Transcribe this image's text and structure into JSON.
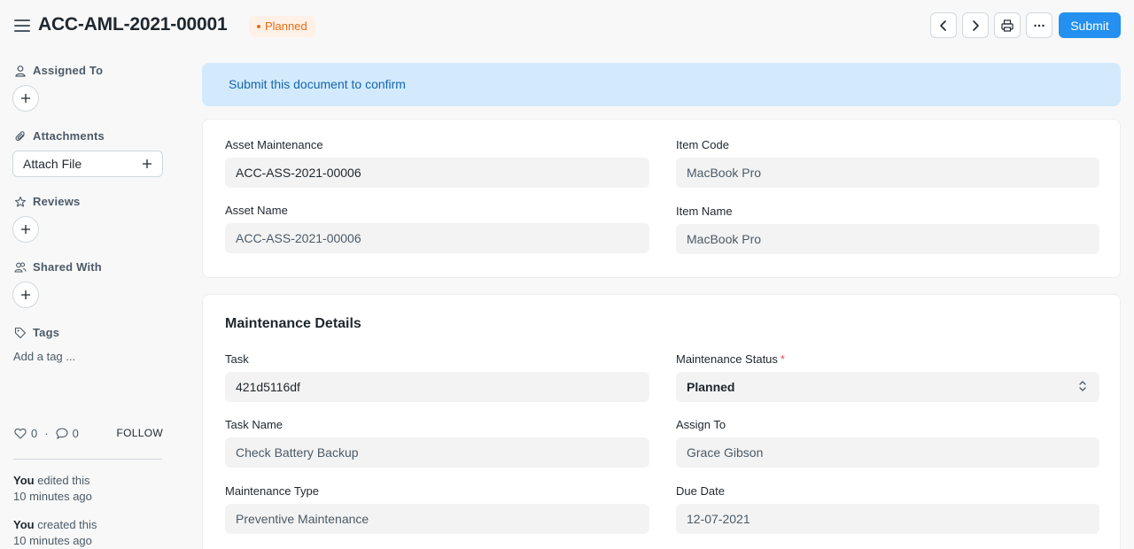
{
  "header": {
    "title": "ACC-AML-2021-00001",
    "status": "Planned",
    "submit_label": "Submit"
  },
  "sidebar": {
    "assigned_to": "Assigned To",
    "attachments": "Attachments",
    "attach_file": "Attach File",
    "reviews": "Reviews",
    "shared_with": "Shared With",
    "tags": "Tags",
    "add_tag": "Add a tag ...",
    "likes": "0",
    "comments": "0",
    "follow": "FOLLOW",
    "activity": [
      {
        "user": "You",
        "action": " edited this",
        "time": "10 minutes ago"
      },
      {
        "user": "You",
        "action": " created this",
        "time": "10 minutes ago"
      }
    ]
  },
  "alert": "Submit this document to confirm",
  "form": {
    "asset_maintenance": {
      "label": "Asset Maintenance",
      "value": "ACC-ASS-2021-00006"
    },
    "item_code": {
      "label": "Item Code",
      "value": "MacBook Pro"
    },
    "asset_name": {
      "label": "Asset Name",
      "value": "ACC-ASS-2021-00006"
    },
    "item_name": {
      "label": "Item Name",
      "value": "MacBook Pro"
    },
    "section_title": "Maintenance Details",
    "task": {
      "label": "Task",
      "value": "421d5116df"
    },
    "maintenance_status": {
      "label": "Maintenance Status",
      "required": "*",
      "value": "Planned"
    },
    "task_name": {
      "label": "Task Name",
      "value": "Check Battery Backup"
    },
    "assign_to": {
      "label": "Assign To",
      "value": "Grace Gibson"
    },
    "maintenance_type": {
      "label": "Maintenance Type",
      "value": "Preventive Maintenance"
    },
    "due_date": {
      "label": "Due Date",
      "value": "12-07-2021"
    }
  },
  "colors": {
    "primary": "#2490ef",
    "status_orange": "#e86c13",
    "alert_bg": "#d3eafd",
    "alert_text": "#1366ae"
  }
}
